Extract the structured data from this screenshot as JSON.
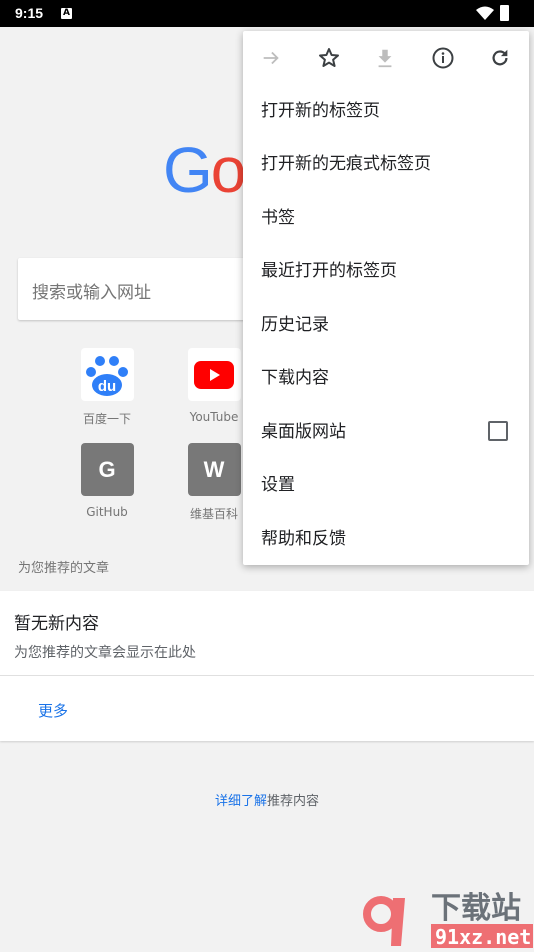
{
  "status_bar": {
    "time": "9:15",
    "notification_icon": "a-icon",
    "wifi_icon": "wifi-icon",
    "battery_icon": "battery-charging-icon"
  },
  "logo": {
    "visible_text": "Go"
  },
  "search": {
    "placeholder": "搜索或输入网址"
  },
  "shortcuts": [
    {
      "label": "百度一下",
      "icon": "baidu-paw-icon"
    },
    {
      "label": "YouTube",
      "icon": "youtube-icon"
    },
    {
      "label": "GitHub",
      "letter": "G"
    },
    {
      "label": "维基百科",
      "letter": "W"
    }
  ],
  "articles": {
    "section_title": "为您推荐的文章",
    "empty_title": "暂无新内容",
    "empty_subtitle": "为您推荐的文章会显示在此处",
    "more": "更多"
  },
  "learn_more": {
    "link": "详细了解",
    "rest": "推荐内容"
  },
  "menu": {
    "icons": [
      "forward-icon",
      "bookmark-star-icon",
      "download-icon",
      "info-icon",
      "refresh-icon"
    ],
    "items": [
      "打开新的标签页",
      "打开新的无痕式标签页",
      "书签",
      "最近打开的标签页",
      "历史记录",
      "下载内容",
      "桌面版网站",
      "设置",
      "帮助和反馈"
    ],
    "desktop_site_checked": false
  },
  "watermark": {
    "text": "91下载站 91xz.net"
  },
  "colors": {
    "accent": "#1a73e8",
    "google_blue": "#4285f4",
    "google_red": "#ea4335",
    "watermark": "#ee6f73"
  }
}
